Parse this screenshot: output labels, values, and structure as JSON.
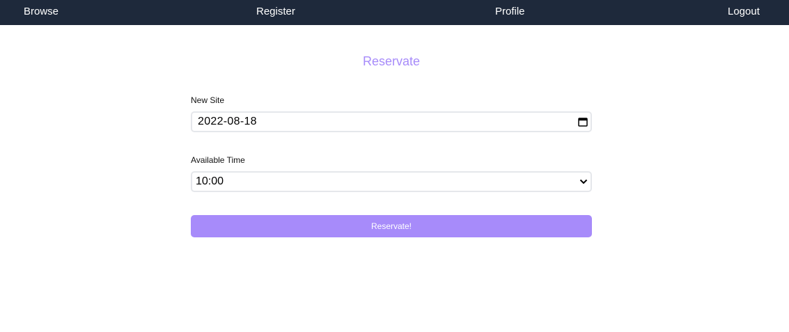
{
  "nav": {
    "browse": "Browse",
    "register": "Register",
    "profile": "Profile",
    "logout": "Logout",
    "background_color": "#1e293b"
  },
  "page": {
    "title": "Reservate",
    "accent_color": "#a78bfa"
  },
  "form": {
    "date_label": "New Site",
    "date_value": "2022-08-18",
    "time_label": "Available Time",
    "time_value": "10:00",
    "submit_label": "Reservate!"
  },
  "icons": {
    "date_picker": "calendar-icon",
    "select_arrow": "chevron-down-icon"
  }
}
